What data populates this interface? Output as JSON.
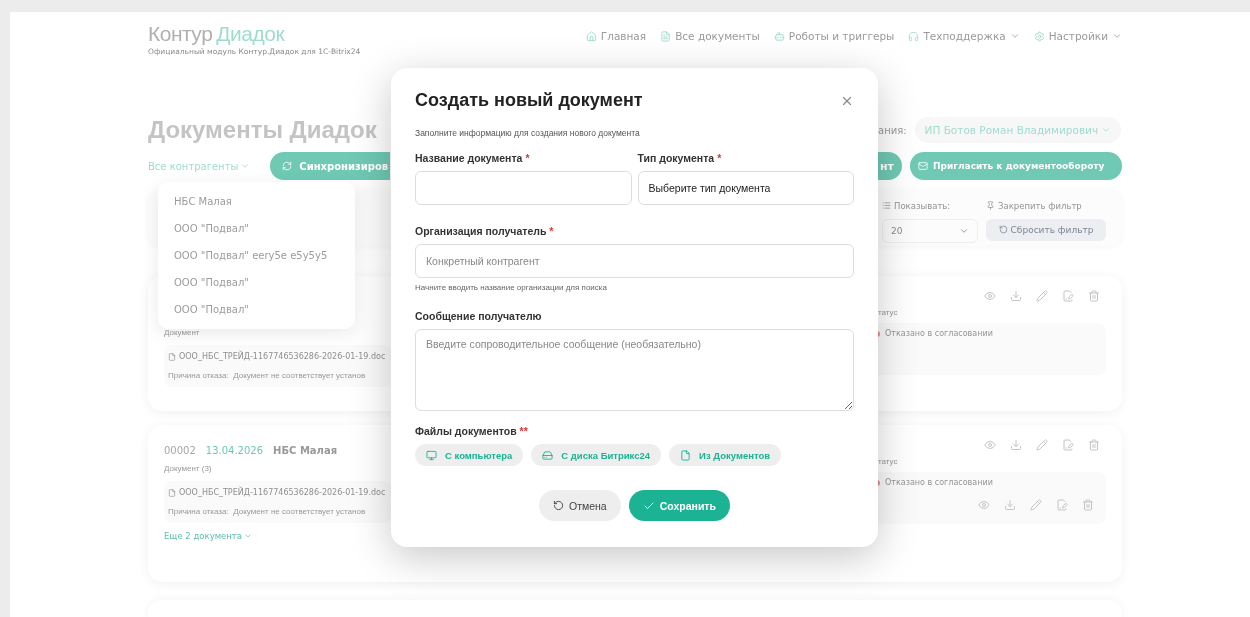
{
  "header": {
    "logo_primary": "Контур",
    "logo_accent": "Диадок",
    "subtitle": "Официальный модуль Контур.Диадок для 1С-Bitrix24",
    "nav": [
      {
        "label": "Главная",
        "dropdown": false
      },
      {
        "label": "Все документы",
        "dropdown": false
      },
      {
        "label": "Роботы и триггеры",
        "dropdown": false
      },
      {
        "label": "Техподдержка",
        "dropdown": true
      },
      {
        "label": "Настройки",
        "dropdown": true
      }
    ]
  },
  "page": {
    "title": "Документы Диадок",
    "org_label": "ания:",
    "org_value": "ИП Ботов Роман Владимирович"
  },
  "toolbar": {
    "counterparty_filter": "Все контрагенты",
    "sync_button": "Синхронизиров",
    "partial_button": "нт",
    "invite_button": "Пригласить к документообороту"
  },
  "counterparty_menu": {
    "items": [
      "НБС Малая",
      "ООО \"Подвал\"",
      "ООО \"Подвал\" eery5e e5y5y5",
      "ООО \"Подвал\"",
      "ООО \"Подвал\""
    ]
  },
  "filters": {
    "show_label": "Показывать:",
    "per_page": "20",
    "pin_label": "Закрепить фильтр",
    "reset_button": "Сбросить фильтр"
  },
  "cards": [
    {
      "doc_label": "Документ",
      "file": "ООО_НБС_ТРЕЙД-1167746536286-2026-01-19.doc",
      "reason_label": "Причина отказа:",
      "reason": "Документ не соответствует установ",
      "status_label": "татус",
      "status": "Отказано в согласовании",
      "extra_actions": false
    },
    {
      "number": "00002",
      "date": "13.04.2026",
      "counterparty": "НБС Малая",
      "doc_label": "Документ (3)",
      "file": "ООО_НБС_ТРЕЙД-1167746536286-2026-01-19.doc",
      "reason_label": "Причина отказа:",
      "reason": "Документ не соответствует установ",
      "more": "Еще 2 документа",
      "status_label": "татус",
      "status": "Отказано в согласовании",
      "extra_actions": true
    }
  ],
  "modal": {
    "title": "Создать новый документ",
    "subtitle": "Заполните информацию для создания нового документа",
    "name_field": {
      "label": "Название документа",
      "required_mark": "*"
    },
    "type_field": {
      "label": "Тип документа",
      "required_mark": "*",
      "value": "Выберите тип документа"
    },
    "recipient_field": {
      "label": "Организация получатель",
      "required_mark": "*",
      "placeholder": "Конкретный контрагент",
      "hint": "Начните вводить название организации для поиска"
    },
    "message_field": {
      "label": "Сообщение получателю",
      "placeholder": "Введите сопроводительное сообщение (необязательно)"
    },
    "files": {
      "label": "Файлы документов",
      "required_mark": "**",
      "sources": [
        {
          "label": "С компьютера"
        },
        {
          "label": "С диска Битрикс24"
        },
        {
          "label": "Из Документов"
        }
      ]
    },
    "buttons": {
      "cancel": "Отмена",
      "save": "Сохранить"
    }
  }
}
